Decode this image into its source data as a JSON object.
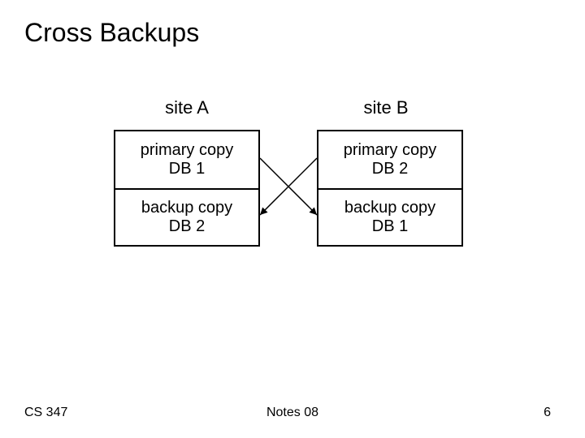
{
  "title": "Cross Backups",
  "sites": {
    "a": {
      "label": "site A",
      "primary": "primary copy\nDB 1",
      "backup": "backup copy\nDB 2"
    },
    "b": {
      "label": "site B",
      "primary": "primary copy\nDB 2",
      "backup": "backup copy\nDB 1"
    }
  },
  "footer": {
    "course": "CS 347",
    "notes": "Notes 08",
    "page": "6"
  }
}
